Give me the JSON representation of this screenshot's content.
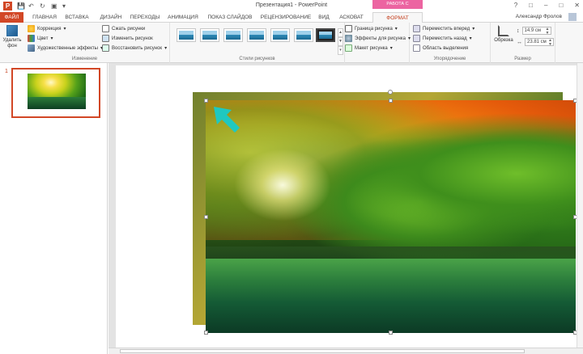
{
  "window": {
    "title": "Презентация1 - PowerPoint",
    "context_tab_title": "РАБОТА С РИСУНКАМИ"
  },
  "tabs": {
    "file": "ФАЙЛ",
    "home": "ГЛАВНАЯ",
    "insert": "ВСТАВКА",
    "design": "ДИЗАЙН",
    "transitions": "ПЕРЕХОДЫ",
    "animations": "АНИМАЦИЯ",
    "slideshow": "ПОКАЗ СЛАЙДОВ",
    "review": "РЕЦЕНЗИРОВАНИЕ",
    "view": "ВИД",
    "asc": "АСКОВАТ",
    "format": "ФОРМАТ"
  },
  "user": {
    "name": "Александр Фролов"
  },
  "ribbon": {
    "adjust": {
      "remove_bg": "Удалить фон",
      "correction": "Коррекция",
      "color": "Цвет",
      "artistic": "Художественные эффекты",
      "compress": "Сжать рисунки",
      "change": "Изменить рисунок",
      "reset": "Восстановить рисунок",
      "label": "Изменение"
    },
    "styles": {
      "label": "Стили рисунков"
    },
    "picture_opts": {
      "border": "Граница рисунка",
      "effects": "Эффекты для рисунка",
      "layout": "Макет рисунка"
    },
    "arrange": {
      "forward": "Переместить вперед",
      "backward": "Переместить назад",
      "selection": "Область выделения",
      "label": "Упорядочение"
    },
    "size": {
      "crop": "Обрезка",
      "height": "14.9 см",
      "width": "23.81 см",
      "label": "Размер"
    }
  },
  "slides": {
    "current_number": "1"
  },
  "colors": {
    "file_tab": "#d24726",
    "context": "#ec64a1",
    "accent": "#c43e1c",
    "arrow": "#1fc8c0"
  }
}
